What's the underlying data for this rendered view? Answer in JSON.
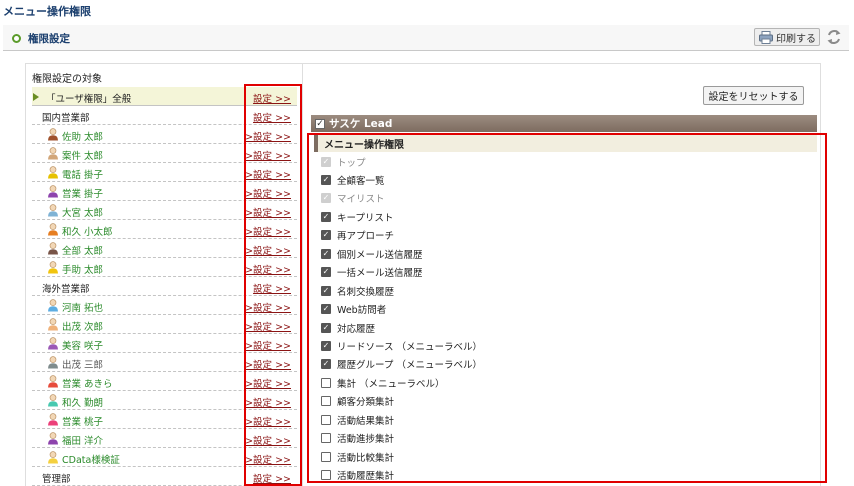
{
  "page": {
    "title": "メニュー操作権限"
  },
  "header": {
    "section_title": "権限設定",
    "print_label": "印刷する",
    "icons": {
      "section": "circle-bullet-icon",
      "print": "printer-icon",
      "refresh": "refresh-icon"
    }
  },
  "left": {
    "heading": "権限設定の対象",
    "rows": [
      {
        "type": "all",
        "label": "「ユーザ権限」全般",
        "link": "設定 >>",
        "selected": true
      },
      {
        "type": "group",
        "label": "国内営業部",
        "link": "設定 >>"
      },
      {
        "type": "user",
        "label": "佐助 太郎",
        "link": ">設定 >>",
        "color": "#a0522d"
      },
      {
        "type": "user",
        "label": "案件 太郎",
        "link": ">設定 >>",
        "color": "#d2a679"
      },
      {
        "type": "user",
        "label": "電話 掛子",
        "link": ">設定 >>",
        "color": "#e6c100"
      },
      {
        "type": "user",
        "label": "営業 掛子",
        "link": ">設定 >>",
        "color": "#8e44ad"
      },
      {
        "type": "user",
        "label": "大宮 太郎",
        "link": ">設定 >>",
        "color": "#7fb3d5"
      },
      {
        "type": "user",
        "label": "和久 小太郎",
        "link": ">設定 >>",
        "color": "#e67e22"
      },
      {
        "type": "user",
        "label": "全部 太郎",
        "link": ">設定 >>",
        "color": "#795548"
      },
      {
        "type": "user",
        "label": "手助 太郎",
        "link": ">設定 >>",
        "color": "#f1c40f"
      },
      {
        "type": "group",
        "label": "海外営業部",
        "link": "設定 >>"
      },
      {
        "type": "user",
        "label": "河南 拓也",
        "link": ">設定 >>",
        "color": "#5dade2"
      },
      {
        "type": "user",
        "label": "出茂 次郎",
        "link": ">設定 >>",
        "color": "#f0b27a"
      },
      {
        "type": "user",
        "label": "美容 咲子",
        "link": ">設定 >>",
        "color": "#9b59b6"
      },
      {
        "type": "user",
        "label": "出茂 三郎",
        "link": ">設定 >>",
        "color": "#7f8c8d",
        "muted": true
      },
      {
        "type": "user",
        "label": "営業 あきら",
        "link": ">設定 >>",
        "color": "#e74c3c"
      },
      {
        "type": "user",
        "label": "和久 勤朗",
        "link": ">設定 >>",
        "color": "#48c9b0"
      },
      {
        "type": "user",
        "label": "営業 桃子",
        "link": ">設定 >>",
        "color": "#ec407a"
      },
      {
        "type": "user",
        "label": "福田 洋介",
        "link": ">設定 >>",
        "color": "#8e44ad"
      },
      {
        "type": "user",
        "label": "CData様検証",
        "link": ">設定 >>",
        "color": "#f4d03f"
      },
      {
        "type": "group",
        "label": "管理部",
        "link": "設定 >>"
      }
    ]
  },
  "right": {
    "reset_label": "設定をリセットする",
    "product_label": "サスケ Lead",
    "menu_label": "メニュー操作権限",
    "items": [
      {
        "label": "トップ",
        "state": "disabled"
      },
      {
        "label": "全顧客一覧",
        "state": "checked"
      },
      {
        "label": "マイリスト",
        "state": "disabled"
      },
      {
        "label": "キープリスト",
        "state": "checked"
      },
      {
        "label": "再アプローチ",
        "state": "checked"
      },
      {
        "label": "個別メール送信履歴",
        "state": "checked"
      },
      {
        "label": "一括メール送信履歴",
        "state": "checked"
      },
      {
        "label": "名刺交換履歴",
        "state": "checked"
      },
      {
        "label": "Web訪問者",
        "state": "checked"
      },
      {
        "label": "対応履歴",
        "state": "checked"
      },
      {
        "label": "リードソース （メニューラベル）",
        "state": "checked"
      },
      {
        "label": "履歴グループ （メニューラベル）",
        "state": "checked"
      },
      {
        "label": "集計 （メニューラベル）",
        "state": "unchecked"
      },
      {
        "label": "顧客分類集計",
        "state": "unchecked"
      },
      {
        "label": "活動結果集計",
        "state": "unchecked"
      },
      {
        "label": "活動進捗集計",
        "state": "unchecked"
      },
      {
        "label": "活動比較集計",
        "state": "unchecked"
      },
      {
        "label": "活動履歴集計",
        "state": "unchecked"
      }
    ]
  },
  "colors": {
    "highlight_border": "#e00000",
    "link": "#8b1414",
    "user_name": "#2a8a2a"
  }
}
